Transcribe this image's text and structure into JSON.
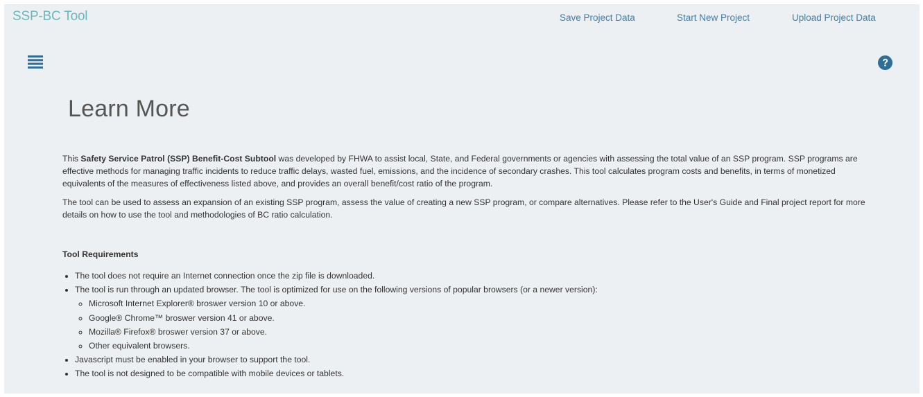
{
  "header": {
    "brand": "SSP-BC Tool",
    "nav": {
      "save": "Save Project Data",
      "start": "Start New Project",
      "upload": "Upload Project Data"
    }
  },
  "icons": {
    "menu": "hamburger-menu-icon",
    "help": "question-circle-icon"
  },
  "colors": {
    "background": "#edf0f2",
    "brand": "#6ab8bf",
    "link": "#3b7fa8",
    "icon": "#2f6f97"
  },
  "main": {
    "title": "Learn More",
    "intro": {
      "before": "This ",
      "bold": "Safety Service Patrol (SSP) Benefit-Cost Subtool",
      "after": " was developed by FHWA to assist local, State, and Federal governments or agencies with assessing the total value of an SSP program. SSP programs are effective methods for managing traffic incidents to reduce traffic delays, wasted fuel, emissions, and the incidence of secondary crashes. This tool calculates program costs and benefits, in terms of monetized equivalents of the measures of effectiveness listed above, and provides an overall benefit/cost ratio of the program."
    },
    "paragraph2": "The tool can be used to assess an expansion of an existing SSP program, assess the value of creating a new SSP program, or compare alternatives. Please refer to the User's Guide and Final project report for more details on how to use the tool and methodologies of BC ratio calculation.",
    "requirements": {
      "heading": "Tool Requirements",
      "items": [
        "The tool does not require an Internet connection once the zip file is downloaded.",
        "The tool is run through an updated browser. The tool is optimized for use on the following versions of popular browsers (or a newer version):",
        "Javascript must be enabled in your browser to support the tool.",
        "The tool is not designed to be compatible with mobile devices or tablets."
      ],
      "browsers": [
        "Microsoft Internet Explorer® broswer version 10 or above.",
        "Google® Chrome™ broswer version 41 or above.",
        "Mozilla® Firefox® broswer version 37 or above.",
        "Other equivalent browsers."
      ]
    }
  }
}
